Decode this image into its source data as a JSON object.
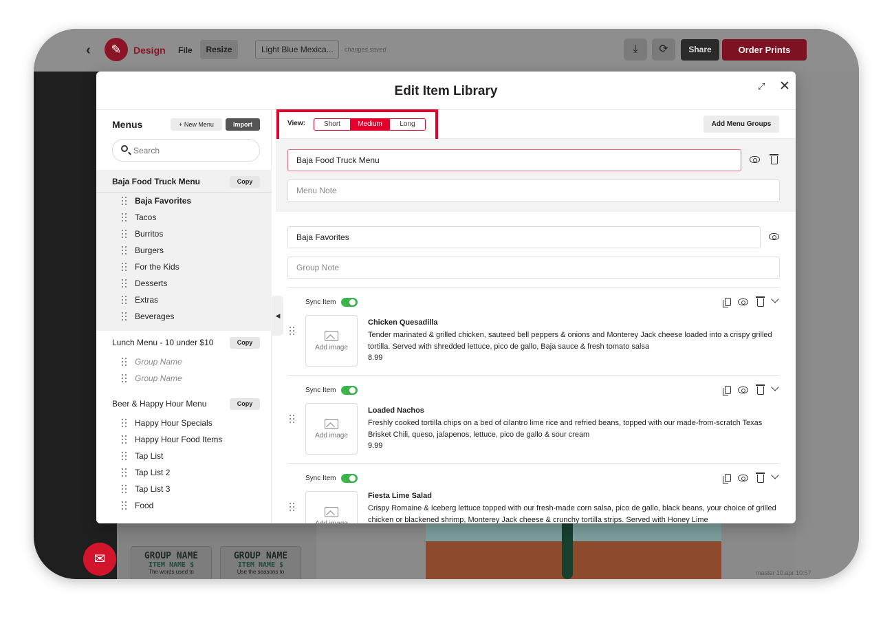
{
  "topbar": {
    "back": "‹",
    "design": "Design",
    "file": "File",
    "resize": "Resize",
    "doc_name": "Light Blue Mexica...",
    "saved": "changes saved",
    "share": "Share",
    "order_prints": "Order Prints"
  },
  "background": {
    "group_cards": [
      {
        "title": "GROUP NAME",
        "item": "ITEM NAME $",
        "caption": "The words used to"
      },
      {
        "title": "GROUP NAME",
        "item": "ITEM NAME $",
        "caption": "Use the seasons to"
      }
    ],
    "version": "master 10.apr 10:57"
  },
  "modal": {
    "title": "Edit Item Library",
    "sidebar": {
      "title": "Menus",
      "new_menu": "+ New Menu",
      "import": "Import",
      "search_placeholder": "Search",
      "menus": [
        {
          "name": "Baja Food Truck Menu",
          "copy": "Copy",
          "groups": [
            "Baja Favorites",
            "Tacos",
            "Burritos",
            "Burgers",
            "For the Kids",
            "Desserts",
            "Extras",
            "Beverages"
          ]
        },
        {
          "name": "Lunch Menu - 10 under $10",
          "copy": "Copy",
          "groups": [
            "Group Name",
            "Group Name"
          ]
        },
        {
          "name": "Beer & Happy Hour Menu",
          "copy": "Copy",
          "groups": [
            "Happy Hour Specials",
            "Happy Hour Food Items",
            "Tap List",
            "Tap List 2",
            "Tap List 3",
            "Food"
          ]
        }
      ]
    },
    "main": {
      "view_label": "View:",
      "view_options": [
        "Short",
        "Medium",
        "Long"
      ],
      "view_selected": "Medium",
      "add_menu_groups": "Add Menu Groups",
      "menu_name": "Baja Food Truck Menu",
      "menu_note_placeholder": "Menu Note",
      "group_name": "Baja Favorites",
      "group_note_placeholder": "Group Note",
      "sync_label": "Sync Item",
      "add_image": "Add image",
      "items": [
        {
          "name": "Chicken Quesadilla",
          "desc": "Tender marinated & grilled chicken, sauteed bell peppers & onions and Monterey Jack cheese loaded into a crispy grilled tortilla. Served with shredded lettuce, pico de gallo, Baja sauce & fresh tomato salsa",
          "price": "8.99",
          "sync": true
        },
        {
          "name": "Loaded Nachos",
          "desc": "Freshly cooked tortilla chips on a bed of cilantro lime rice and refried beans, topped with our made-from-scratch Texas Brisket Chili, queso, jalapenos, lettuce, pico de gallo & sour cream",
          "price": "9.99",
          "sync": true
        },
        {
          "name": "Fiesta Lime Salad",
          "desc": "Crispy Romaine & Iceberg lettuce topped with our fresh-made corn salsa, pico de gallo, black beans, your choice of grilled chicken or blackened shrimp, Monterey Jack cheese & crunchy tortilla strips. Served with Honey Lime",
          "price": "",
          "sync": true
        }
      ]
    }
  }
}
